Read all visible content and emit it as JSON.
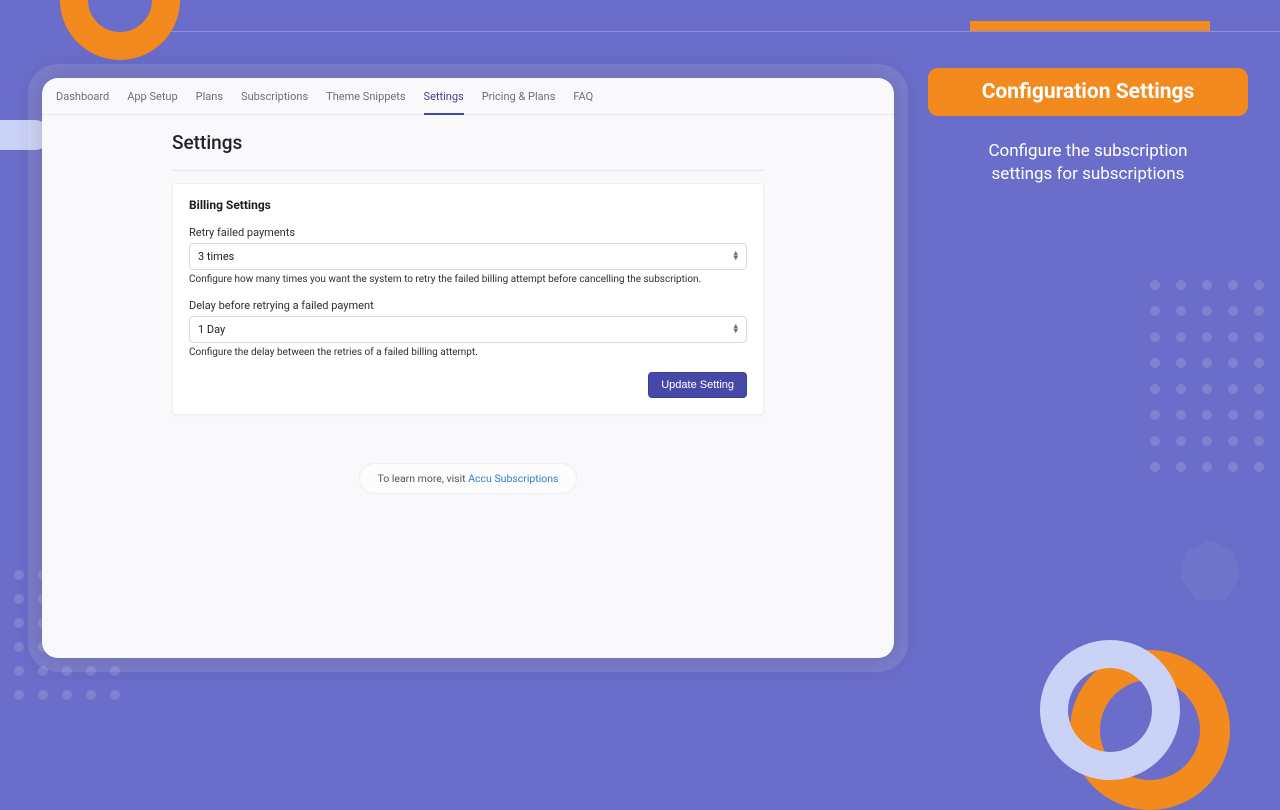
{
  "tabs": {
    "dashboard": "Dashboard",
    "app_setup": "App Setup",
    "plans": "Plans",
    "subscriptions": "Subscriptions",
    "theme_snippets": "Theme Snippets",
    "settings": "Settings",
    "pricing_plans": "Pricing & Plans",
    "faq": "FAQ"
  },
  "page": {
    "title": "Settings"
  },
  "card": {
    "title": "Billing Settings",
    "retry": {
      "label": "Retry failed payments",
      "value": "3 times",
      "help": "Configure how many times you want the system to retry the failed billing attempt before cancelling the subscription."
    },
    "delay": {
      "label": "Delay before retrying a failed payment",
      "value": "1 Day",
      "help": "Configure the delay between the retries of a failed billing attempt."
    },
    "button": "Update Setting"
  },
  "learn": {
    "prefix": "To learn more, visit ",
    "link": "Accu Subscriptions"
  },
  "info": {
    "badge": "Configuration Settings",
    "desc": "Configure the subscription settings for subscriptions"
  }
}
